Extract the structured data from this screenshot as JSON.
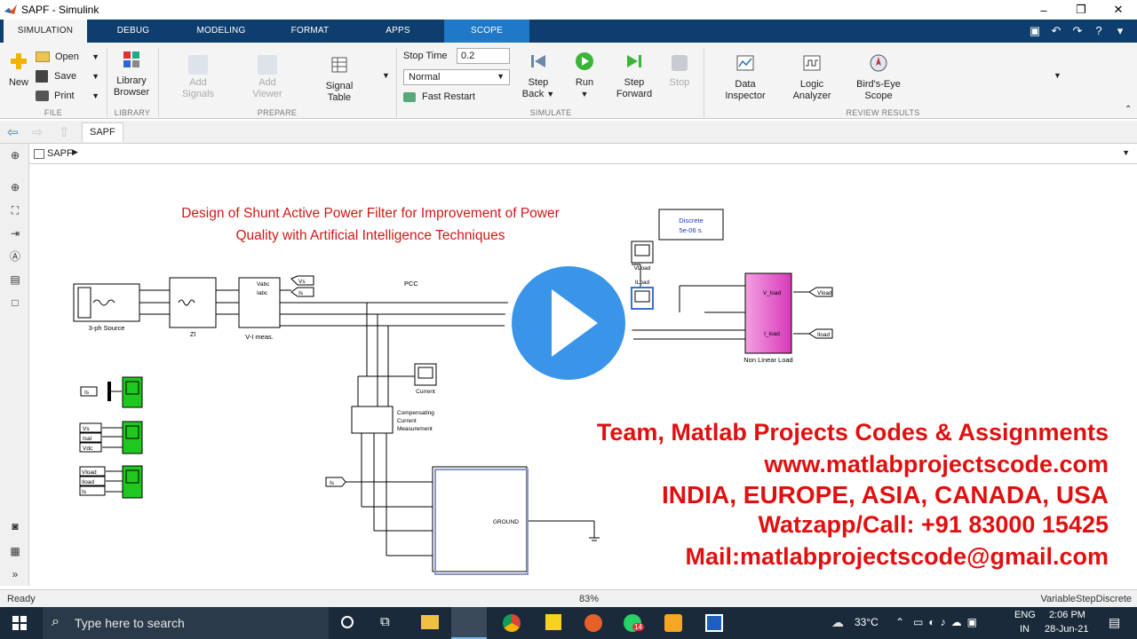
{
  "window": {
    "title": "SAPF - Simulink",
    "minimize": "‒",
    "maximize": "❐",
    "close": "✕"
  },
  "tabs": [
    "SIMULATION",
    "DEBUG",
    "MODELING",
    "FORMAT",
    "APPS",
    "SCOPE"
  ],
  "file": {
    "new": "New",
    "open": "Open",
    "save": "Save",
    "print": "Print",
    "section": "FILE"
  },
  "library": {
    "label1": "Library",
    "label2": "Browser",
    "section": "LIBRARY"
  },
  "prepare": {
    "add_signal1": "Add",
    "add_signal2": "Signals",
    "add_viewer1": "Add",
    "add_viewer2": "Viewer",
    "signal_table1": "Signal",
    "signal_table2": "Table",
    "section": "PREPARE"
  },
  "simulate": {
    "stop_time_label": "Stop Time",
    "stop_time_value": "0.2",
    "mode": "Normal",
    "fast_restart": "Fast Restart",
    "step_back1": "Step",
    "step_back2": "Back",
    "run": "Run",
    "step_fwd1": "Step",
    "step_fwd2": "Forward",
    "stop": "Stop",
    "section": "SIMULATE"
  },
  "review": {
    "data_inspector1": "Data",
    "data_inspector2": "Inspector",
    "logic1": "Logic",
    "logic2": "Analyzer",
    "birds1": "Bird's-Eye",
    "birds2": "Scope",
    "section": "REVIEW RESULTS"
  },
  "nav": {
    "model_tab": "SAPF",
    "breadcrumb": "SAPF"
  },
  "diagram": {
    "title_line1": "Design of Shunt Active Power Filter for Improvement of Power",
    "title_line2": "Quality with Artificial Intelligence Techniques",
    "powergui1": "Discrete",
    "powergui2": "5e-06 s.",
    "source_label": "3-ph Source",
    "zl_label": "Zl",
    "vi_label": "V-I meas.",
    "pcc_label": "PCC",
    "vload_label": "VLoad",
    "iload_label": "ILoad",
    "current_label": "Current",
    "comp1": "Compensating",
    "comp2": "Current",
    "comp3": "Measurement",
    "nonlinear_label": "Non Linear Load",
    "ground_port": "GROUND",
    "vload_out": "Vload",
    "iload_out": "Iload",
    "vabc": "Vabc",
    "iabc": "Iabc",
    "vs_tag": "Vs",
    "is_tag": "Is",
    "v_load_port": "V_load",
    "i_load_port": "I_load",
    "tag_is1": "Is",
    "tag_vs": "Vs",
    "tag_isal": "Isal",
    "tag_vdc": "Vdc",
    "tag_vload": "Vload",
    "tag_iload": "Iload",
    "tag_is2": "Is",
    "tag_is3": "Is"
  },
  "watermark": {
    "line1": "Team, Matlab Projects Codes & Assignments",
    "line2": "www.matlabprojectscode.com",
    "line3": "INDIA, EUROPE, ASIA, CANADA, USA",
    "line4": "Watzapp/Call: +91 83000 15425",
    "line5": "Mail:matlabprojectscode@gmail.com"
  },
  "status": {
    "left": "Ready",
    "zoom": "83%",
    "solver": "VariableStepDiscrete"
  },
  "taskbar": {
    "search_placeholder": "Type here to search",
    "temp": "33°C",
    "lang1": "ENG",
    "lang2": "IN",
    "time": "2:06 PM",
    "date": "28-Jun-21",
    "whatsapp_badge": "14"
  },
  "colors": {
    "tabbar": "#0e3e6e",
    "scope_tab": "#1f78c8",
    "watermark_red": "#e01010",
    "title_red": "#d01818",
    "play_blue": "#3a95e8",
    "scope_green": "#1ec81e",
    "load_pink": "#e050c8"
  }
}
